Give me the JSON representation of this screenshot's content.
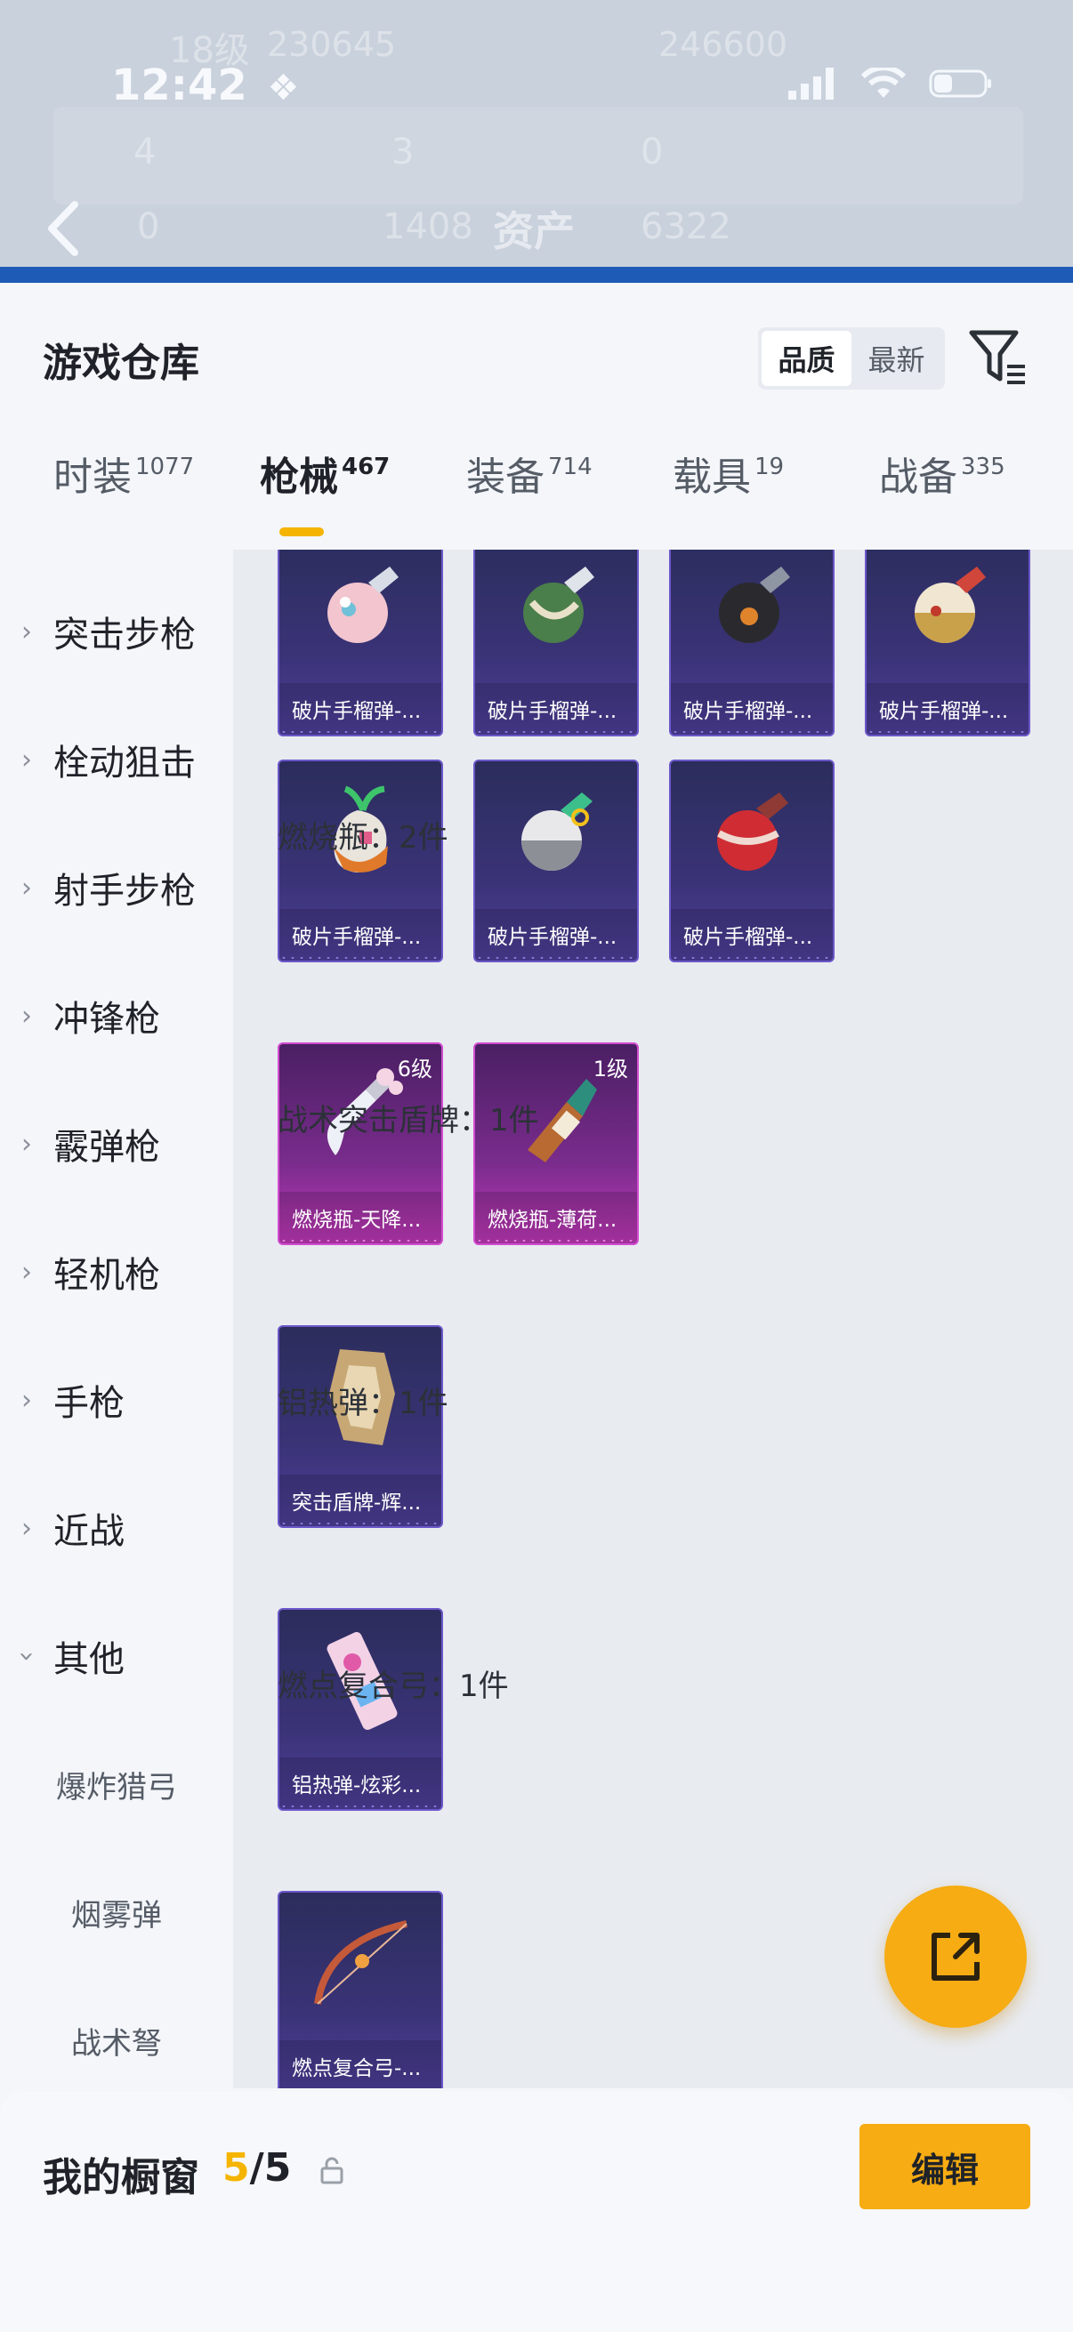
{
  "status": {
    "time": "12:42"
  },
  "background": {
    "level_text": "18级",
    "score_left": "230645",
    "score_right": "246600",
    "stat1": "4",
    "stat2": "3",
    "stat3": "0",
    "back_stat": "0",
    "asset_value": "1408",
    "asset_label": "资产",
    "asset_value2": "6322"
  },
  "header": {
    "title": "游戏仓库",
    "sort_options": [
      "品质",
      "最新"
    ],
    "sort_selected": "品质"
  },
  "tabs": [
    {
      "label": "时装",
      "count": "1077"
    },
    {
      "label": "枪械",
      "count": "467"
    },
    {
      "label": "装备",
      "count": "714"
    },
    {
      "label": "载具",
      "count": "19"
    },
    {
      "label": "战备",
      "count": "335"
    }
  ],
  "active_tab": "枪械",
  "sidebar": {
    "categories": [
      "突击步枪",
      "栓动狙击",
      "射手步枪",
      "冲锋枪",
      "霰弹枪",
      "轻机枪",
      "手枪",
      "近战",
      "其他"
    ],
    "subcategories": [
      "爆炸猎弓",
      "烟雾弹",
      "战术弩"
    ]
  },
  "content": {
    "grenades_row1": [
      "破片手榴弹-...",
      "破片手榴弹-...",
      "破片手榴弹-...",
      "破片手榴弹-..."
    ],
    "grenades_row2": [
      "破片手榴弹-...",
      "破片手榴弹-...",
      "破片手榴弹-..."
    ],
    "group_molotov": "燃烧瓶：2件",
    "molotovs": [
      {
        "name": "燃烧瓶-天降...",
        "level": "6级"
      },
      {
        "name": "燃烧瓶-薄荷...",
        "level": "1级"
      }
    ],
    "group_shield": "战术突击盾牌：1件",
    "shield": "突击盾牌-辉...",
    "group_thermite": "铝热弹：1件",
    "thermite": "铝热弹-炫彩...",
    "group_bow": "燃点复合弓：1件",
    "bow": "燃点复合弓-..."
  },
  "bottom_bar": {
    "title": "我的橱窗",
    "count_current": "5",
    "count_total": "/5",
    "edit_label": "编辑"
  },
  "colors": {
    "accent": "#f6ac12",
    "card_blue": "#3a3377",
    "card_pink": "#c039b8"
  }
}
